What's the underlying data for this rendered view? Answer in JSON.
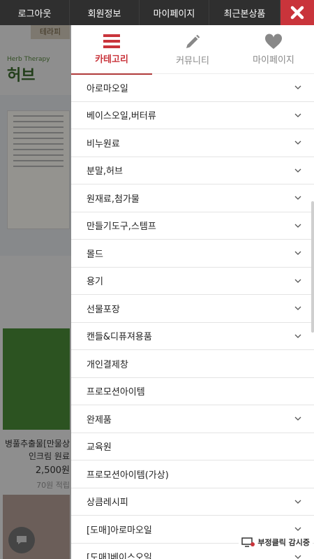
{
  "topbar": {
    "logout": "로그아웃",
    "member_info": "회원정보",
    "mypage": "마이페이지",
    "recent": "최근본상품"
  },
  "background": {
    "logo": "테라피",
    "brand": "허브",
    "brand_sub": "Herb Therapy",
    "product_name_1": "병풀추출물[만물상",
    "product_name_2": "인크림 원료",
    "product_price": "2,500원",
    "product_point": "70원 적립"
  },
  "menu": {
    "tabs": [
      {
        "label": "카테고리",
        "icon": "menu-icon",
        "active": true
      },
      {
        "label": "커뮤니티",
        "icon": "pencil-icon",
        "active": false
      },
      {
        "label": "마이페이지",
        "icon": "heart-icon",
        "active": false
      }
    ],
    "items": [
      {
        "label": "아로마오일",
        "has_sub": true
      },
      {
        "label": "베이스오일,버터류",
        "has_sub": true
      },
      {
        "label": "비누원료",
        "has_sub": true
      },
      {
        "label": "분말,허브",
        "has_sub": true
      },
      {
        "label": "원재료,첨가물",
        "has_sub": true
      },
      {
        "label": "만들기도구,스템프",
        "has_sub": true
      },
      {
        "label": "몰드",
        "has_sub": true
      },
      {
        "label": "용기",
        "has_sub": true
      },
      {
        "label": "선물포장",
        "has_sub": true
      },
      {
        "label": "캔들&디퓨져용품",
        "has_sub": true
      },
      {
        "label": "개인결제창",
        "has_sub": false
      },
      {
        "label": "프로모션아이템",
        "has_sub": false
      },
      {
        "label": "완제품",
        "has_sub": true
      },
      {
        "label": "교육원",
        "has_sub": false
      },
      {
        "label": "프로모션아이템(가상)",
        "has_sub": false
      },
      {
        "label": "상큼레시피",
        "has_sub": true
      },
      {
        "label": "[도매]아로마오일",
        "has_sub": true
      },
      {
        "label": "[도매]베이스오일",
        "has_sub": true
      }
    ]
  },
  "fraud_badge": "부정클릭 감시중",
  "colors": {
    "accent": "#c9343b",
    "topbar": "#2f2f2f"
  }
}
